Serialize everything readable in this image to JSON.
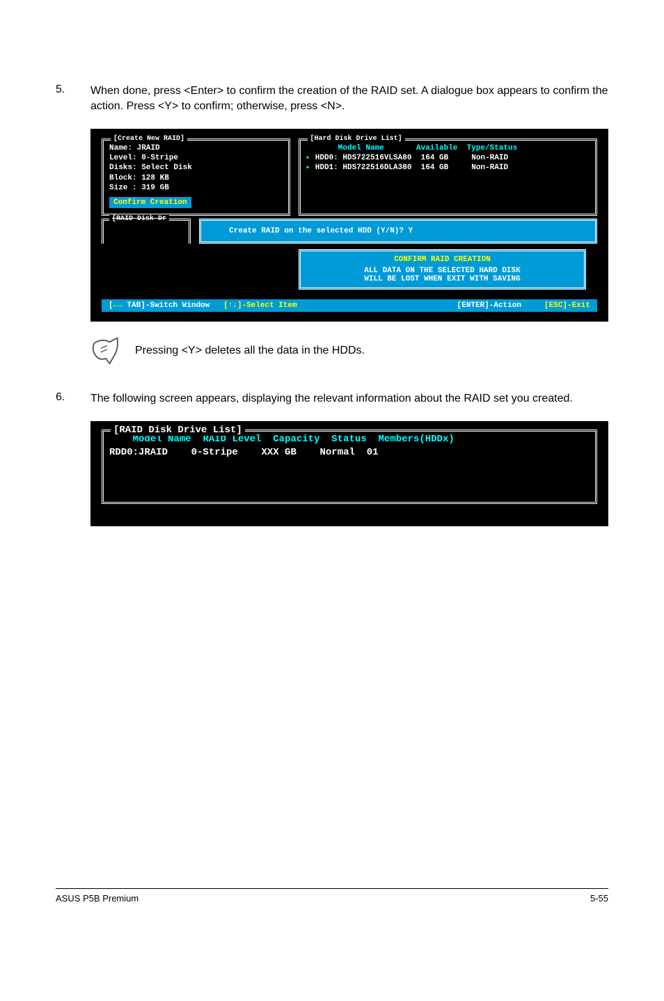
{
  "step5": {
    "num": "5.",
    "text": "When done, press <Enter> to confirm the creation of the RAID set. A dialogue box appears to confirm the action. Press <Y> to confirm; otherwise, press <N>."
  },
  "bios1": {
    "create_title": "[Create New RAID]",
    "hdd_title": "[Hard Disk Drive List]",
    "name": "Name: JRAID",
    "level": "Level: 0-Stripe",
    "disks": "Disks: Select Disk",
    "block": "Block: 128 KB",
    "size": "Size : 319 GB",
    "confirm_creation": "Confirm Creation",
    "hdr": {
      "model": "Model Name",
      "avail": "Available",
      "type": "Type/Status"
    },
    "rows": [
      {
        "marker": "▸ ",
        "disk": "HDD0:",
        "model": "HDS722516VLSA80",
        "size": "164 GB",
        "status": "Non-RAID"
      },
      {
        "marker": "▸ ",
        "disk": "HDD1:",
        "model": "HDS722516DLA380",
        "size": "164 GB",
        "status": "Non-RAID"
      }
    ],
    "raid_disk_title": "[RAID Disk Dr",
    "prompt": "Create RAID on the selected HDD (Y/N)? Y",
    "warn_title": "CONFIRM RAID CREATION",
    "warn_l1": "ALL DATA ON THE SELECTED HARD DISK",
    "warn_l2": "WILL BE LOST WHEN EXIT WITH SAVING",
    "footer": {
      "tab": "TAB]-Switch Window",
      "arrows": "[↑↓]-Select Item",
      "enter": "[ENTER]-Action",
      "esc": "[ESC]-Exit"
    }
  },
  "note": "Pressing <Y> deletes all the data in the HDDs.",
  "step6": {
    "num": "6.",
    "text": "The following screen appears, displaying the relevant information about the RAID set you created."
  },
  "bios2": {
    "title": "[RAID Disk Drive List]",
    "hdr": {
      "model": "Model Name",
      "level": "RAID Level",
      "cap": "Capacity",
      "status": "Status",
      "members": "Members(HDDx)"
    },
    "row": {
      "name": "RDD0:JRAID",
      "level": "0-Stripe",
      "cap": "XXX GB",
      "status": "Normal",
      "members": "01"
    }
  },
  "footer": {
    "left": "ASUS P5B Premium",
    "right": "5-55"
  }
}
